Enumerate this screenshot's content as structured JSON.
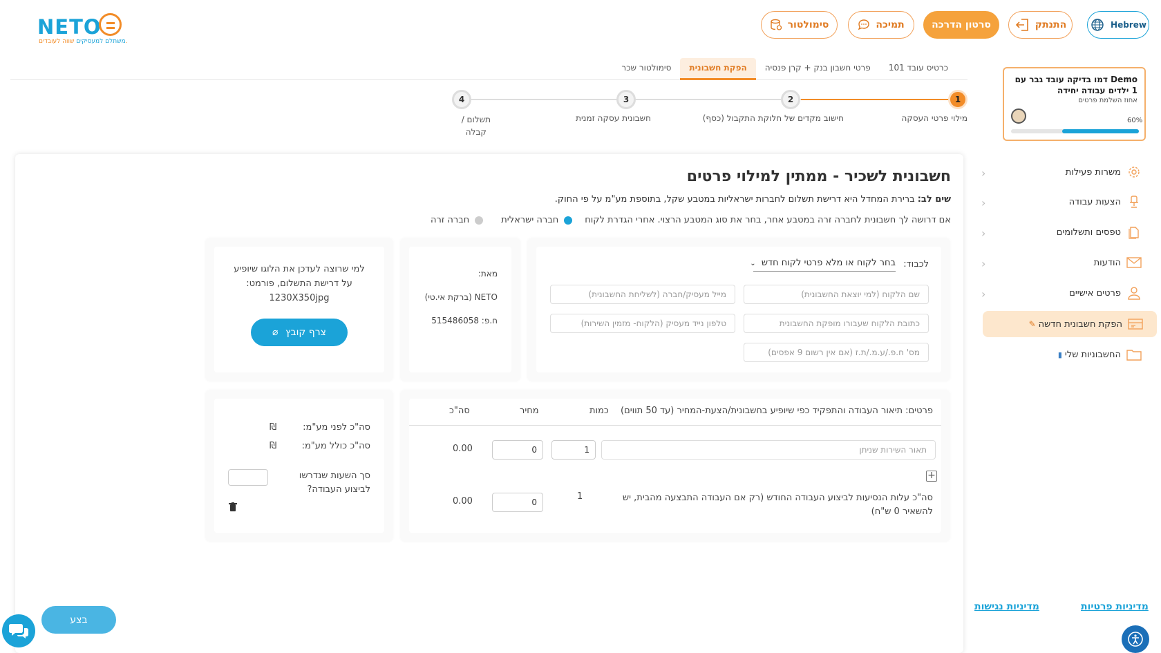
{
  "header": {
    "logo_brand": "NETO",
    "logo_tag_1": "שווה לעובדים.",
    "logo_tag_2": "משתלם למעסיקים",
    "simulator": "סימולטור",
    "support": "תמיכה",
    "guide": "סרטון הדרכה",
    "logout": "התנתק",
    "language": "Hebrew"
  },
  "profile": {
    "name": "Demo דמו בדיקה עובד גבר עם 1 ילדים עבודה יחידה",
    "subtitle": "אחוז השלמת פרטים",
    "percent_label": "60%",
    "percent_value": 0.6
  },
  "sidebar": {
    "items": [
      {
        "label": "משרות פעילות",
        "icon": "gear-icon"
      },
      {
        "label": "הצעות עבודה",
        "icon": "chair-icon"
      },
      {
        "label": "טפסים ותשלומים",
        "icon": "documents-icon"
      },
      {
        "label": "הודעות",
        "icon": "envelope-icon"
      },
      {
        "label": "פרטים אישיים",
        "icon": "user-icon"
      },
      {
        "label": "הפקת חשבונית חדשה",
        "icon": "invoice-icon"
      },
      {
        "label": "החשבוניות שלי",
        "icon": "folder-icon"
      }
    ],
    "privacy_policy": "מדיניות פרטיות",
    "accessibility_policy": "מדיניות נגישות"
  },
  "tabs": [
    {
      "label": "כרטיס עובד 101"
    },
    {
      "label": "פרטי חשבון בנק + קרן פנסיה"
    },
    {
      "label": "הפקת חשבונית"
    },
    {
      "label": "סימולטור שכר"
    }
  ],
  "steps": [
    {
      "num": "1",
      "label": "מילוי פרטי העסקה"
    },
    {
      "num": "2",
      "label": "חישוב מקדים של חלוקת התקבול (כסף)"
    },
    {
      "num": "3",
      "label": "חשבונית עסקה זמנית"
    },
    {
      "num": "4",
      "label_1": "תשלום /",
      "label_2": "קבלה"
    }
  ],
  "form": {
    "title": "חשבונית לשכיר - ממתין למילוי פרטים",
    "note_bold": "שים לב:",
    "note_text": "ברירת המחדל היא דרישת תשלום לחברות ישראליות במטבע שקל, בתוספת מע\"מ על פי החוק.",
    "currency_note": "אם דרושה לך חשבונית לחברה זרה במטבע אחר, בחר את סוג המטבע הרצוי. אחרי הגדרת לקוח",
    "radio_israeli": "חברה ישראלית",
    "radio_foreign": "חברה זרה",
    "to_label": "לכבוד:",
    "client_select": "בחר לקוח או מלא פרטי לקוח חדש",
    "placeholders": {
      "client_name": "שם הלקוח (למי יוצאת החשבונית)",
      "client_address": "כתובת הלקוח שעבורו מופקת החשבונית",
      "client_id": "מס' ח.פ./ע.מ./ת.ז (אם אין רשום 9 אפסים)",
      "employer_email": "מייל מעסיק/חברה (לשליחת החשבונית)",
      "employer_phone": "טלפון נייד מעסיק (הלקוח- מזמין השירות)",
      "service_desc": "תאור השירות שניתן"
    },
    "from_label": "מאת:",
    "from_name": "NETO (ברקת אי.טי)",
    "from_id": "ח.פ: 515486058",
    "logo_note_1": "למי שרוצה לעדכן את הלוגו שיופיע",
    "logo_note_2": "על דרישת התשלום, פורמט:",
    "logo_note_3": "1230X350jpg",
    "attach_button": "צרף קובץ",
    "items_header": "פרטים: תיאור העבודה והתפקיד כפי שיופיע בחשבונית/הצעת-המחיר (עד 50 תווים)",
    "col_qty": "כמות",
    "col_price": "מחיר",
    "col_total": "סה\"כ",
    "row_qty": "1",
    "row_price": "0",
    "row_total": "0.00",
    "travel_text_1": "סה\"כ עלות הנסיעות לביצוע העבודה החודש (רק אם העבודה התבצעה מהבית, יש",
    "travel_text_2": "להשאיר 0 ש\"ח)",
    "travel_qty": "1",
    "travel_price": "0",
    "travel_total": "0.00",
    "sum_before_vat": "סה\"כ לפני מע\"מ:",
    "sum_with_vat": "סה\"כ כולל מע\"מ:",
    "currency_symbol": "₪",
    "hours_question_1": "סך השעות שנדרשו",
    "hours_question_2": "לביצוע העבודה?",
    "submit": "בצע"
  }
}
